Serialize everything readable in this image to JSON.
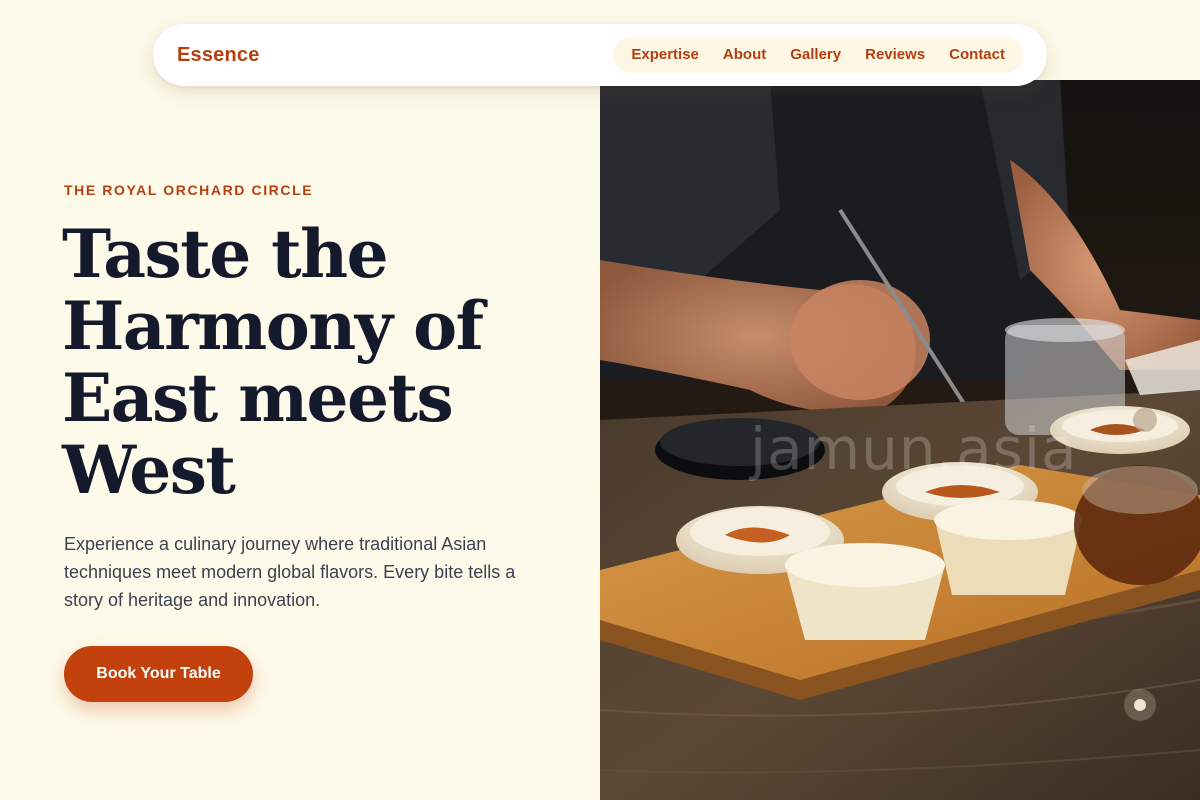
{
  "nav": {
    "brand": "Essence",
    "links": [
      "Expertise",
      "About",
      "Gallery",
      "Reviews",
      "Contact"
    ]
  },
  "hero": {
    "eyebrow": "THE ROYAL ORCHARD CIRCLE",
    "headline_lines": [
      "Taste the",
      "Harmony of",
      "East meets",
      "West"
    ],
    "lead": "Experience a culinary journey where traditional Asian techniques meet modern global flavors. Every bite tells a story of heritage and innovation.",
    "cta_label": "Book Your Table",
    "image_watermark": "jamun.asia"
  },
  "colors": {
    "background": "#fefaea",
    "accent": "#c2410c",
    "brand_text": "#b5400f",
    "headline": "#141a2b"
  }
}
